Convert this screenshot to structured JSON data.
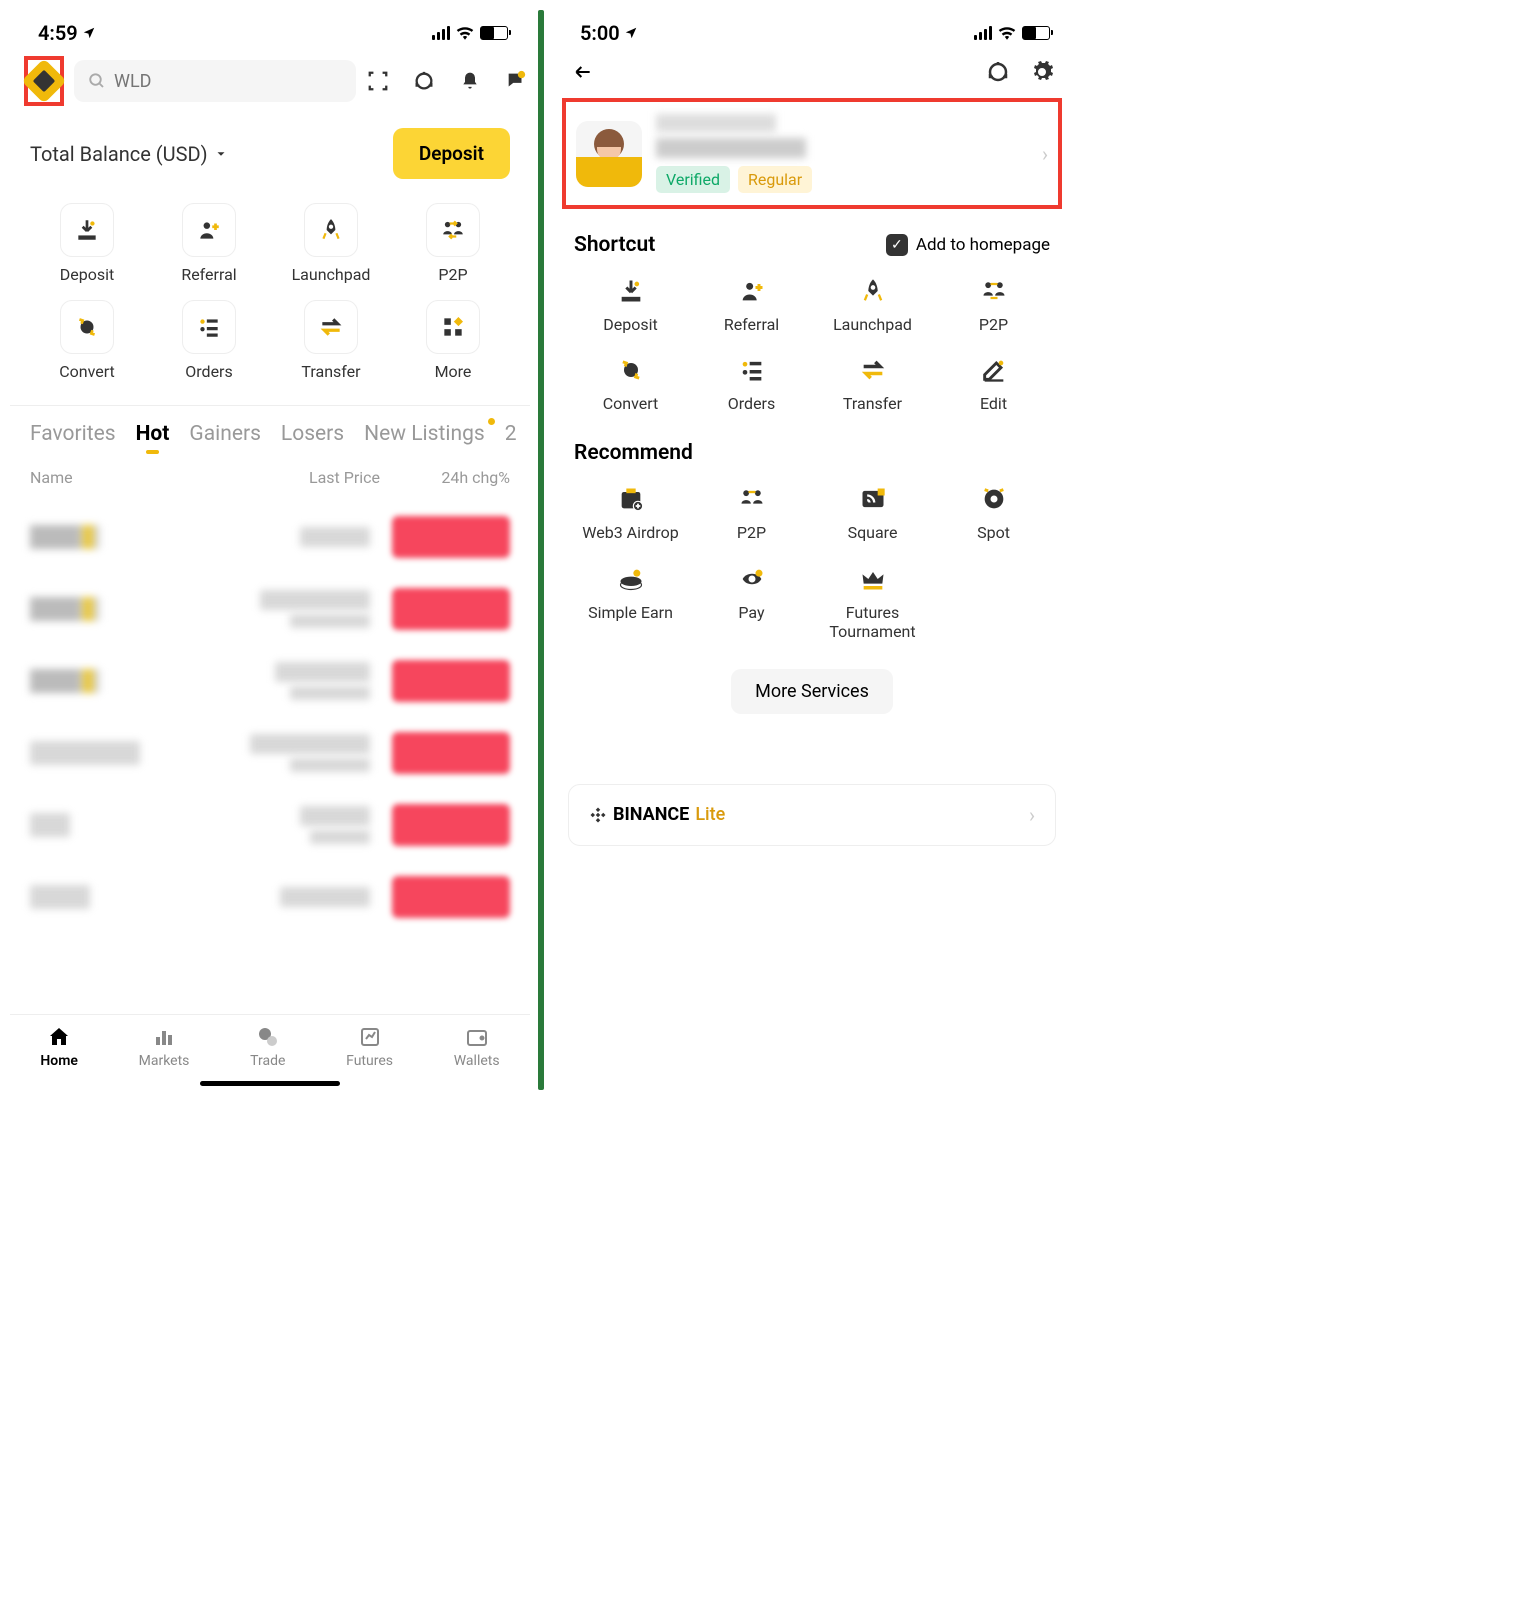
{
  "screen1": {
    "status": {
      "time": "4:59"
    },
    "search": {
      "placeholder": "WLD"
    },
    "balance": {
      "label": "Total Balance (USD)",
      "deposit_btn": "Deposit"
    },
    "shortcuts": [
      {
        "label": "Deposit"
      },
      {
        "label": "Referral"
      },
      {
        "label": "Launchpad"
      },
      {
        "label": "P2P"
      },
      {
        "label": "Convert"
      },
      {
        "label": "Orders"
      },
      {
        "label": "Transfer"
      },
      {
        "label": "More"
      }
    ],
    "tabs": [
      "Favorites",
      "Hot",
      "Gainers",
      "Losers",
      "New Listings",
      "2"
    ],
    "active_tab": "Hot",
    "table_head": {
      "name": "Name",
      "price": "Last Price",
      "chg": "24h chg%"
    },
    "bottom_nav": [
      {
        "label": "Home",
        "active": true
      },
      {
        "label": "Markets"
      },
      {
        "label": "Trade"
      },
      {
        "label": "Futures"
      },
      {
        "label": "Wallets"
      }
    ]
  },
  "screen2": {
    "status": {
      "time": "5:00"
    },
    "profile": {
      "verified": "Verified",
      "regular": "Regular"
    },
    "shortcut_title": "Shortcut",
    "add_homepage": "Add to homepage",
    "shortcuts": [
      {
        "label": "Deposit"
      },
      {
        "label": "Referral"
      },
      {
        "label": "Launchpad"
      },
      {
        "label": "P2P"
      },
      {
        "label": "Convert"
      },
      {
        "label": "Orders"
      },
      {
        "label": "Transfer"
      },
      {
        "label": "Edit"
      }
    ],
    "recommend_title": "Recommend",
    "recommend": [
      {
        "label": "Web3 Airdrop"
      },
      {
        "label": "P2P"
      },
      {
        "label": "Square"
      },
      {
        "label": "Spot"
      },
      {
        "label": "Simple Earn"
      },
      {
        "label": "Pay"
      },
      {
        "label": "Futures Tournament"
      }
    ],
    "more_services": "More Services",
    "lite": {
      "brand": "BINANCE",
      "suffix": "Lite"
    }
  }
}
